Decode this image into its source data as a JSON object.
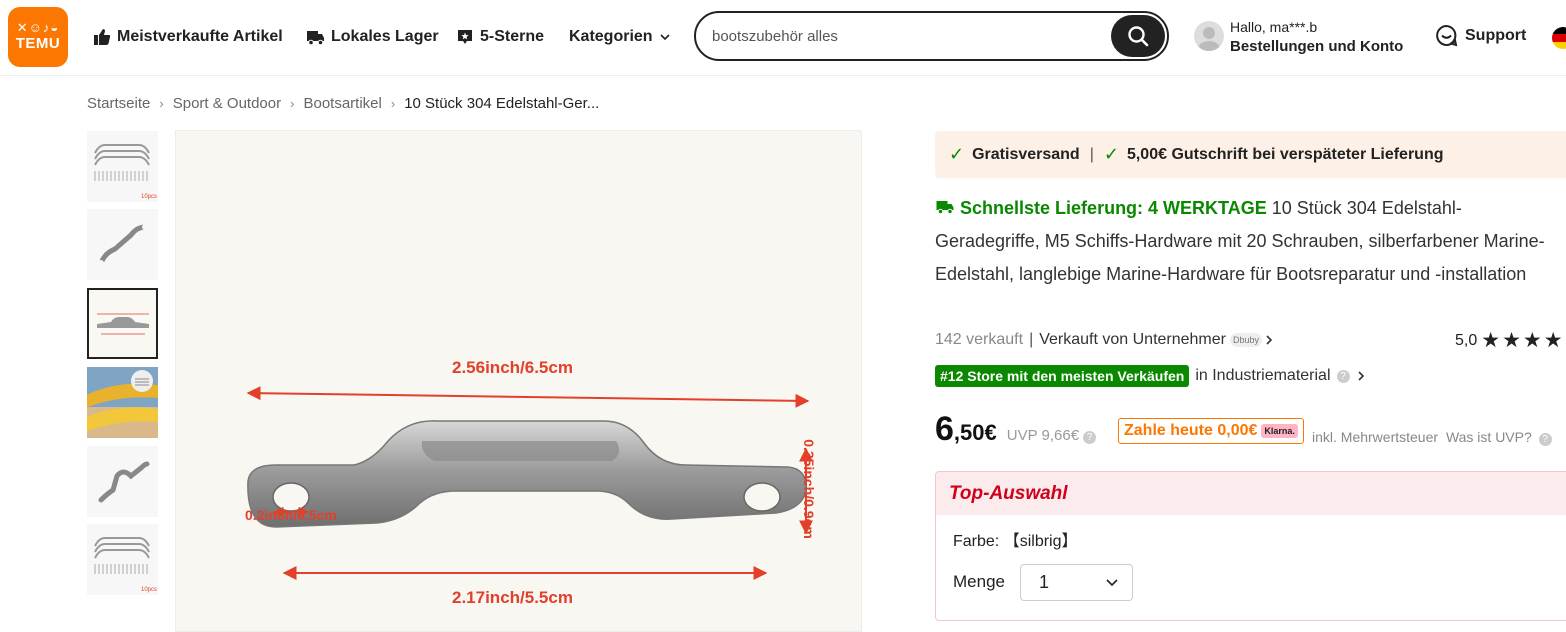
{
  "header": {
    "logo_icons": "✕☺♪◒",
    "logo_text": "TEMU",
    "nav": [
      {
        "label": "Meistverkaufte Artikel",
        "icon": "thumbs-up-icon"
      },
      {
        "label": "Lokales Lager",
        "icon": "truck-icon"
      },
      {
        "label": "5-Sterne",
        "icon": "star-badge-icon"
      },
      {
        "label": "Kategorien",
        "icon": "chevron-down-icon"
      }
    ],
    "search": {
      "value": "bootszubehör alles",
      "icon": "search-icon"
    },
    "account": {
      "greeting": "Hallo, ma***.b",
      "label": "Bestellungen und Konto"
    },
    "support": "Support",
    "flag_colors": [
      "#000000",
      "#dd0000",
      "#ffce00"
    ]
  },
  "breadcrumb": [
    "Startseite",
    "Sport & Outdoor",
    "Bootsartikel",
    "10 Stück 304 Edelstahl-Ger..."
  ],
  "thumbnails": {
    "badge": "10pcs"
  },
  "image": {
    "dim_top": "2.56inch/6.5cm",
    "dim_bottom": "2.17inch/5.5cm",
    "dim_hole": "0.2inch/0.5cm",
    "dim_height": "0.35inch/0.9cm"
  },
  "shipping": {
    "free": "Gratisversand",
    "credit": "5,00€ Gutschrift bei verspäteter Lieferung"
  },
  "product": {
    "fast_delivery": "Schnellste Lieferung: 4 WERKTAGE",
    "title": "10 Stück 304 Edelstahl-Geradegriffe, M5 Schiffs-Hardware mit 20 Schrauben, silberfarbener Marine-Edelstahl, langlebige Marine-Hardware für Bootsreparatur und -installation",
    "sold": "142 verkauft",
    "seller": "Verkauft von Unternehmer",
    "seller_logo": "Dbuby",
    "rating": "5,0",
    "rank_badge": "#12 Store mit den meisten Verkäufen",
    "rank_category": "in Industriematerial",
    "price_main": "6",
    "price_rest": ",50€",
    "uvp_label": "UVP",
    "uvp_value": "9,66€",
    "klarna": "Zahle heute 0,00€",
    "klarna_logo": "Klarna.",
    "tax": "inkl. Mehrwertsteuer",
    "uvp_question": "Was ist UVP?"
  },
  "top_selection": {
    "title": "Top-Auswahl",
    "color_label": "Farbe:",
    "color_value": "【silbrig】",
    "qty_label": "Menge",
    "qty_value": "1"
  },
  "colors": {
    "brand": "#fb7701",
    "green": "#0a8800",
    "red": "#d0021b",
    "dimension": "#e2402a"
  }
}
